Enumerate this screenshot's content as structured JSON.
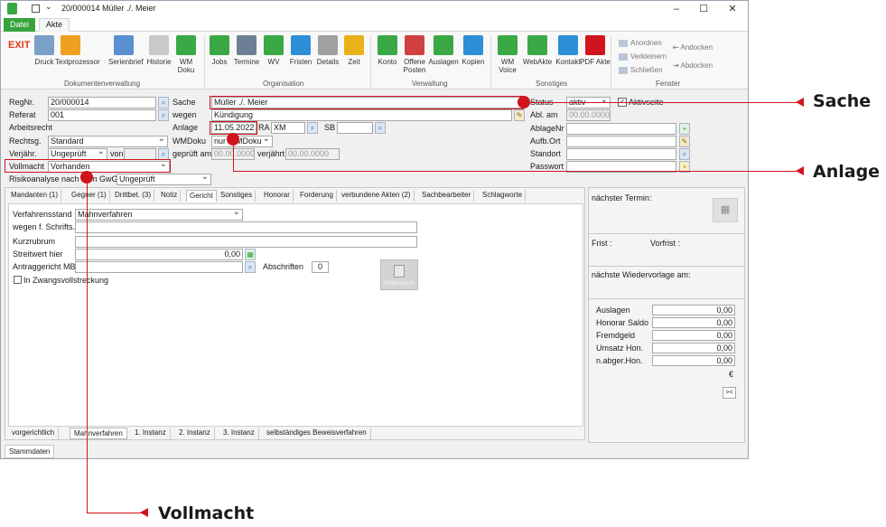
{
  "window": {
    "title": "20/000014 Müller ./. Meier"
  },
  "ribbon_tabs": [
    "Datei",
    "Akte"
  ],
  "ribbon": {
    "exit": "EXIT",
    "buttons": [
      {
        "label": "Druck",
        "icon": "printer-icon",
        "color": "#7aa0c8"
      },
      {
        "label": "Textprozessor",
        "icon": "text-processor-icon",
        "color": "#f0a020"
      },
      {
        "label": "Serienbrief",
        "icon": "serial-letter-icon",
        "color": "#5a8fd0"
      },
      {
        "label": "Historie",
        "icon": "history-folder-icon",
        "color": "#c9c9c9"
      },
      {
        "label": "WM Doku",
        "icon": "wm-doku-icon",
        "color": "#3aa845"
      },
      {
        "label": "Jobs",
        "icon": "jobs-icon",
        "color": "#3aa845"
      },
      {
        "label": "Termine",
        "icon": "calendar-icon",
        "color": "#6d7f94"
      },
      {
        "label": "WV",
        "icon": "wv-icon",
        "color": "#3aa845"
      },
      {
        "label": "Fristen",
        "icon": "deadline-icon",
        "color": "#2d8fd5"
      },
      {
        "label": "Details",
        "icon": "details-icon",
        "color": "#a0a0a0"
      },
      {
        "label": "Zeit",
        "icon": "clock-icon",
        "color": "#e9b21a"
      },
      {
        "label": "Konto",
        "icon": "account-icon",
        "color": "#3aa845"
      },
      {
        "label": "Offene Posten",
        "icon": "open-items-icon",
        "color": "#d04040"
      },
      {
        "label": "Auslagen",
        "icon": "expenses-icon",
        "color": "#3aa845"
      },
      {
        "label": "Kopien",
        "icon": "copies-icon",
        "color": "#2d8fd5"
      },
      {
        "label": "WM Voice",
        "icon": "voice-icon",
        "color": "#3aa845"
      },
      {
        "label": "WebAkte",
        "icon": "webakte-icon",
        "color": "#3aa845"
      },
      {
        "label": "Kontakt",
        "icon": "contact-icon",
        "color": "#2d8fd5"
      },
      {
        "label": "PDF Akte",
        "icon": "pdf-icon",
        "color": "#d0141e"
      }
    ],
    "groups": [
      "Dokumentenverwaltung",
      "Organisation",
      "Verwaltung",
      "Sonstiges",
      "Fenster"
    ],
    "window_actions": [
      "Anordnen",
      "Verkleinern",
      "Schließen",
      "Andocken",
      "Abdocken"
    ]
  },
  "form": {
    "regnr_label": "RegNr.",
    "regnr": "20/000014",
    "referat_label": "Referat",
    "referat": "001",
    "arbeitsrecht": "Arbeitsrecht",
    "rechtsg_label": "Rechtsg.",
    "rechtsg": "Standard",
    "verjaehr_label": "Verjähr.",
    "verjaehr": "Ungeprüft",
    "von_label": "von",
    "vollmacht_label": "Vollmacht",
    "vollmacht": "Vorhanden",
    "risiko_label": "Risikoanalyse nach dem GwG",
    "risiko": "Ungeprüft",
    "sache_label": "Sache",
    "sache": "Müller ./. Meier",
    "wegen_label": "wegen",
    "wegen": "Kündigung",
    "anlage_label": "Anlage",
    "anlage": "11.05.2022",
    "ra_label": "RA",
    "ra": "XM",
    "sb_label": "SB",
    "wmdoku_label": "WMDoku",
    "wmdoku": "nur WMDoku",
    "geprueft_label": "geprüft am",
    "geprueft": "00.00.0000",
    "verjaehrt_label": "verjährt",
    "verjaehrt": "00.00.0000",
    "status_label": "Status",
    "status": "aktiv",
    "aktivseite_label": "Aktivseite",
    "ablam_label": "Abl. am",
    "ablam": "00.00.0000",
    "ablagenr_label": "AblageNr",
    "aufbort_label": "Aufb.Ort",
    "standort_label": "Standort",
    "passwort_label": "Passwort"
  },
  "tabs": [
    "Mandanten (1)",
    "Gegner (1)",
    "Drittbet. (3)",
    "Notiz",
    "Gericht",
    "Sonstiges",
    "Honorar",
    "Forderung",
    "verbundene Akten (2)",
    "Sachbearbeiter",
    "Schlagworte"
  ],
  "gericht": {
    "verfahrensstand_label": "Verfahrensstand",
    "verfahrensstand": "Mahnverfahren",
    "wegen_schrifts_label": "wegen f. Schrifts.",
    "kurzrubrum_label": "Kurzrubrum",
    "streitwert_label": "Streitwert hier",
    "streitwert": "0,00",
    "antraggericht_label": "Antraggericht MB",
    "abschriften_label": "Abschriften",
    "abschriften": "0",
    "zwangs_label": "In Zwangsvollstreckung",
    "widerspruch_label": "Widerspruch"
  },
  "bottom_tabs": [
    "vorgerichtlich",
    "Mahnverfahren",
    "1. Instanz",
    "2. Instanz",
    "3. Instanz",
    "selbständiges Beweisverfahren"
  ],
  "right_panel": {
    "naechster_termin": "nächster Termin:",
    "frist": "Frist :",
    "vorfrist": "Vorfrist :",
    "wiedervorlage": "nächste Wiedervorlage am:",
    "amounts": [
      {
        "label": "Auslagen",
        "value": "0,00"
      },
      {
        "label": "Honorar Saldo",
        "value": "0,00"
      },
      {
        "label": "Fremdgeld",
        "value": "0,00"
      },
      {
        "label": "Umsatz Hon.",
        "value": "0,00"
      },
      {
        "label": "n.abger.Hon.",
        "value": "0,00"
      }
    ],
    "currency": "€",
    "collapse": "><"
  },
  "statusbar": "Stammdaten",
  "callouts": {
    "sache": "Sache",
    "anlage": "Anlage",
    "vollmacht": "Vollmacht"
  },
  "accent_color": "#d0141e"
}
